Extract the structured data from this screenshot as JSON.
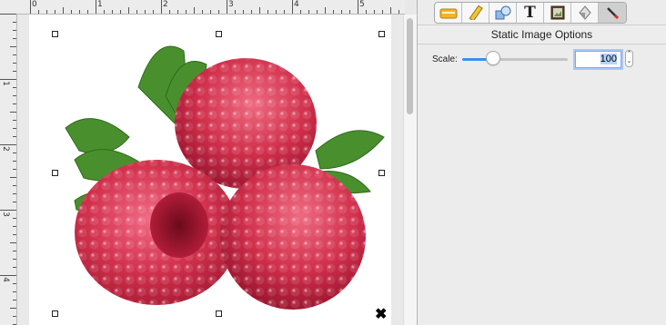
{
  "ruler": {
    "top_labels": [
      "0",
      "1",
      "2",
      "3",
      "4",
      "5"
    ],
    "left_labels": [
      "1",
      "2",
      "3",
      "4"
    ]
  },
  "canvas": {
    "image_subject": "raspberries",
    "selection_cursor": "✖"
  },
  "inspector": {
    "toolbar_icons": [
      "document-icon",
      "ruler-icon",
      "shapes-icon",
      "text-icon",
      "image-icon",
      "fill-icon",
      "pen-icon"
    ],
    "toolbar_text_glyph": "T",
    "panel_title": "Static Image Options",
    "scale_label": "Scale:",
    "scale_value": "100",
    "scale_slider_fraction": 0.29,
    "stepper_up": "⌃",
    "stepper_down": "⌄"
  },
  "colors": {
    "accent": "#3d8ef0",
    "raspberry": "#d3324e",
    "leaf": "#4a8f2e"
  }
}
